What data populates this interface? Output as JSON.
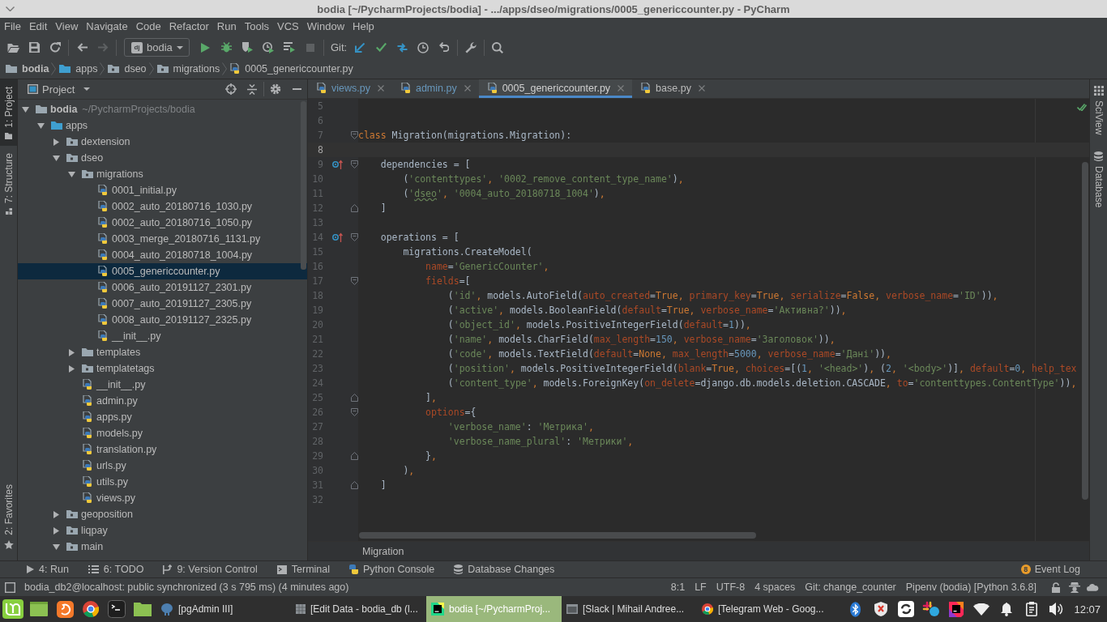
{
  "window": {
    "title": "bodia [~/PycharmProjects/bodia] - .../apps/dseo/migrations/0005_genericcounter.py - PyCharm"
  },
  "menu": [
    "File",
    "Edit",
    "View",
    "Navigate",
    "Code",
    "Refactor",
    "Run",
    "Tools",
    "VCS",
    "Window",
    "Help"
  ],
  "toolbar": {
    "back_enabled": true,
    "forward_enabled": false,
    "run_configuration": {
      "badge": "dj",
      "label": "bodia"
    },
    "stop_enabled": false,
    "vcs_label": "Git:"
  },
  "breadcrumb": [
    {
      "label": "bodia",
      "kind": "root"
    },
    {
      "label": "apps",
      "kind": "source-folder"
    },
    {
      "label": "dseo",
      "kind": "package"
    },
    {
      "label": "migrations",
      "kind": "package"
    },
    {
      "label": "0005_genericcounter.py",
      "kind": "python-file"
    }
  ],
  "left_tool_windows": {
    "top": [
      {
        "label": "1: Project",
        "kind": "project",
        "selected": true
      },
      {
        "label": "7: Structure",
        "kind": "structure",
        "selected": false
      }
    ],
    "bottom": [
      {
        "label": "2: Favorites",
        "kind": "favorites",
        "selected": false
      }
    ]
  },
  "project_panel": {
    "title": "Project",
    "tree": [
      {
        "label": "bodia",
        "location": "~/PycharmProjects/bodia",
        "kind": "root",
        "expanded": true,
        "selected": false,
        "children": [
          {
            "label": "apps",
            "kind": "source-folder",
            "expanded": true,
            "selected": false,
            "children": [
              {
                "label": "dextension",
                "kind": "package",
                "expanded": false,
                "selected": false
              },
              {
                "label": "dseo",
                "kind": "package",
                "expanded": true,
                "selected": false,
                "children": [
                  {
                    "label": "migrations",
                    "kind": "package",
                    "expanded": true,
                    "selected": false,
                    "children": [
                      {
                        "label": "0001_initial.py",
                        "kind": "python-file",
                        "selected": false
                      },
                      {
                        "label": "0002_auto_20180716_1030.py",
                        "kind": "python-file",
                        "selected": false
                      },
                      {
                        "label": "0002_auto_20180716_1050.py",
                        "kind": "python-file",
                        "selected": false
                      },
                      {
                        "label": "0003_merge_20180716_1131.py",
                        "kind": "python-file",
                        "selected": false
                      },
                      {
                        "label": "0004_auto_20180718_1004.py",
                        "kind": "python-file",
                        "selected": false
                      },
                      {
                        "label": "0005_genericcounter.py",
                        "kind": "python-file",
                        "selected": true
                      },
                      {
                        "label": "0006_auto_20191127_2301.py",
                        "kind": "python-file",
                        "selected": false
                      },
                      {
                        "label": "0007_auto_20191127_2305.py",
                        "kind": "python-file",
                        "selected": false
                      },
                      {
                        "label": "0008_auto_20191127_2325.py",
                        "kind": "python-file",
                        "selected": false
                      },
                      {
                        "label": "__init__.py",
                        "kind": "python-file",
                        "selected": false
                      }
                    ]
                  },
                  {
                    "label": "templates",
                    "kind": "folder",
                    "expanded": false,
                    "selected": false
                  },
                  {
                    "label": "templatetags",
                    "kind": "package",
                    "expanded": false,
                    "selected": false
                  },
                  {
                    "label": "__init__.py",
                    "kind": "python-file",
                    "selected": false
                  },
                  {
                    "label": "admin.py",
                    "kind": "python-file",
                    "selected": false
                  },
                  {
                    "label": "apps.py",
                    "kind": "python-file",
                    "selected": false
                  },
                  {
                    "label": "models.py",
                    "kind": "python-file",
                    "selected": false
                  },
                  {
                    "label": "translation.py",
                    "kind": "python-file",
                    "selected": false
                  },
                  {
                    "label": "urls.py",
                    "kind": "python-file",
                    "selected": false
                  },
                  {
                    "label": "utils.py",
                    "kind": "python-file",
                    "selected": false
                  },
                  {
                    "label": "views.py",
                    "kind": "python-file",
                    "selected": false
                  }
                ]
              },
              {
                "label": "geoposition",
                "kind": "package",
                "expanded": false,
                "selected": false
              },
              {
                "label": "liqpay",
                "kind": "package",
                "expanded": false,
                "selected": false
              },
              {
                "label": "main",
                "kind": "package",
                "expanded": true,
                "selected": false
              }
            ]
          }
        ]
      }
    ]
  },
  "editor": {
    "tabs": [
      {
        "label": "views.py",
        "selected": false,
        "modified": true
      },
      {
        "label": "admin.py",
        "selected": false,
        "modified": true
      },
      {
        "label": "0005_genericcounter.py",
        "selected": true,
        "modified": false
      },
      {
        "label": "base.py",
        "selected": false,
        "modified": false
      }
    ],
    "lines": [
      {
        "number": "5",
        "current": false,
        "fold_start": false,
        "fold_end": false,
        "overrides": false
      },
      {
        "number": "6",
        "current": false,
        "fold_start": false,
        "fold_end": false,
        "overrides": false
      },
      {
        "number": "7",
        "current": false,
        "fold_start": true,
        "fold_end": false,
        "overrides": false,
        "tokens": [
          {
            "kind": "keyword",
            "text": "class"
          },
          {
            "kind": "plain",
            "text": " Migration(migrations.Migration):"
          }
        ]
      },
      {
        "number": "8",
        "current": true,
        "fold_start": false,
        "fold_end": false,
        "overrides": false
      },
      {
        "number": "9",
        "current": false,
        "fold_start": true,
        "fold_end": false,
        "overrides": true,
        "tokens": [
          {
            "kind": "plain",
            "text": "    dependencies = ["
          }
        ]
      },
      {
        "number": "10",
        "current": false,
        "fold_start": false,
        "fold_end": false,
        "overrides": false,
        "tokens": [
          {
            "kind": "plain",
            "text": "        ("
          },
          {
            "kind": "string",
            "text": "'contenttypes'"
          },
          {
            "kind": "comma",
            "text": ", "
          },
          {
            "kind": "string",
            "text": "'0002_remove_content_type_name'"
          },
          {
            "kind": "plain",
            "text": ")"
          },
          {
            "kind": "comma",
            "text": ","
          }
        ]
      },
      {
        "number": "11",
        "current": false,
        "fold_start": false,
        "fold_end": false,
        "overrides": false,
        "tokens": [
          {
            "kind": "plain",
            "text": "        ("
          },
          {
            "kind": "string",
            "text": "'"
          },
          {
            "kind": "typo",
            "text": "dseo"
          },
          {
            "kind": "string",
            "text": "'"
          },
          {
            "kind": "comma",
            "text": ", "
          },
          {
            "kind": "string",
            "text": "'0004_auto_20180718_1004'"
          },
          {
            "kind": "plain",
            "text": ")"
          },
          {
            "kind": "comma",
            "text": ","
          }
        ]
      },
      {
        "number": "12",
        "current": false,
        "fold_start": false,
        "fold_end": true,
        "overrides": false,
        "tokens": [
          {
            "kind": "plain",
            "text": "    ]"
          }
        ]
      },
      {
        "number": "13",
        "current": false,
        "fold_start": false,
        "fold_end": false,
        "overrides": false
      },
      {
        "number": "14",
        "current": false,
        "fold_start": true,
        "fold_end": false,
        "overrides": true,
        "tokens": [
          {
            "kind": "plain",
            "text": "    operations = ["
          }
        ]
      },
      {
        "number": "15",
        "current": false,
        "fold_start": false,
        "fold_end": false,
        "overrides": false,
        "tokens": [
          {
            "kind": "plain",
            "text": "        migrations.CreateModel("
          }
        ]
      },
      {
        "number": "16",
        "current": false,
        "fold_start": false,
        "fold_end": false,
        "overrides": false,
        "tokens": [
          {
            "kind": "param",
            "text": "            name"
          },
          {
            "kind": "plain",
            "text": "="
          },
          {
            "kind": "string",
            "text": "'GenericCounter'"
          },
          {
            "kind": "comma",
            "text": ","
          }
        ]
      },
      {
        "number": "17",
        "current": false,
        "fold_start": true,
        "fold_end": false,
        "overrides": false,
        "tokens": [
          {
            "kind": "param",
            "text": "            fields"
          },
          {
            "kind": "plain",
            "text": "=["
          }
        ]
      },
      {
        "number": "18",
        "current": false,
        "fold_start": false,
        "fold_end": false,
        "overrides": false,
        "tokens": [
          {
            "kind": "plain",
            "text": "                ("
          },
          {
            "kind": "string",
            "text": "'id'"
          },
          {
            "kind": "comma",
            "text": ", "
          },
          {
            "kind": "plain",
            "text": "models.AutoField("
          },
          {
            "kind": "param",
            "text": "auto_created"
          },
          {
            "kind": "plain",
            "text": "="
          },
          {
            "kind": "keyword",
            "text": "True"
          },
          {
            "kind": "comma",
            "text": ", "
          },
          {
            "kind": "param",
            "text": "primary_key"
          },
          {
            "kind": "plain",
            "text": "="
          },
          {
            "kind": "keyword",
            "text": "True"
          },
          {
            "kind": "comma",
            "text": ", "
          },
          {
            "kind": "param",
            "text": "serialize"
          },
          {
            "kind": "plain",
            "text": "="
          },
          {
            "kind": "keyword",
            "text": "False"
          },
          {
            "kind": "comma",
            "text": ", "
          },
          {
            "kind": "param",
            "text": "verbose_name"
          },
          {
            "kind": "plain",
            "text": "="
          },
          {
            "kind": "string",
            "text": "'ID'"
          },
          {
            "kind": "plain",
            "text": "))"
          },
          {
            "kind": "comma",
            "text": ","
          }
        ]
      },
      {
        "number": "19",
        "current": false,
        "fold_start": false,
        "fold_end": false,
        "overrides": false,
        "tokens": [
          {
            "kind": "plain",
            "text": "                ("
          },
          {
            "kind": "string",
            "text": "'active'"
          },
          {
            "kind": "comma",
            "text": ", "
          },
          {
            "kind": "plain",
            "text": "models.BooleanField("
          },
          {
            "kind": "param",
            "text": "default"
          },
          {
            "kind": "plain",
            "text": "="
          },
          {
            "kind": "keyword",
            "text": "True"
          },
          {
            "kind": "comma",
            "text": ", "
          },
          {
            "kind": "param",
            "text": "verbose_name"
          },
          {
            "kind": "plain",
            "text": "="
          },
          {
            "kind": "string",
            "text": "'Активна?'"
          },
          {
            "kind": "plain",
            "text": "))"
          },
          {
            "kind": "comma",
            "text": ","
          }
        ]
      },
      {
        "number": "20",
        "current": false,
        "fold_start": false,
        "fold_end": false,
        "overrides": false,
        "tokens": [
          {
            "kind": "plain",
            "text": "                ("
          },
          {
            "kind": "string",
            "text": "'object_id'"
          },
          {
            "kind": "comma",
            "text": ", "
          },
          {
            "kind": "plain",
            "text": "models.PositiveIntegerField("
          },
          {
            "kind": "param",
            "text": "default"
          },
          {
            "kind": "plain",
            "text": "="
          },
          {
            "kind": "number",
            "text": "1"
          },
          {
            "kind": "plain",
            "text": "))"
          },
          {
            "kind": "comma",
            "text": ","
          }
        ]
      },
      {
        "number": "21",
        "current": false,
        "fold_start": false,
        "fold_end": false,
        "overrides": false,
        "tokens": [
          {
            "kind": "plain",
            "text": "                ("
          },
          {
            "kind": "string",
            "text": "'name'"
          },
          {
            "kind": "comma",
            "text": ", "
          },
          {
            "kind": "plain",
            "text": "models.CharField("
          },
          {
            "kind": "param",
            "text": "max_length"
          },
          {
            "kind": "plain",
            "text": "="
          },
          {
            "kind": "number",
            "text": "150"
          },
          {
            "kind": "comma",
            "text": ", "
          },
          {
            "kind": "param",
            "text": "verbose_name"
          },
          {
            "kind": "plain",
            "text": "="
          },
          {
            "kind": "string",
            "text": "'Заголовок'"
          },
          {
            "kind": "plain",
            "text": "))"
          },
          {
            "kind": "comma",
            "text": ","
          }
        ]
      },
      {
        "number": "22",
        "current": false,
        "fold_start": false,
        "fold_end": false,
        "overrides": false,
        "tokens": [
          {
            "kind": "plain",
            "text": "                ("
          },
          {
            "kind": "string",
            "text": "'code'"
          },
          {
            "kind": "comma",
            "text": ", "
          },
          {
            "kind": "plain",
            "text": "models.TextField("
          },
          {
            "kind": "param",
            "text": "default"
          },
          {
            "kind": "plain",
            "text": "="
          },
          {
            "kind": "keyword",
            "text": "None"
          },
          {
            "kind": "comma",
            "text": ", "
          },
          {
            "kind": "param",
            "text": "max_length"
          },
          {
            "kind": "plain",
            "text": "="
          },
          {
            "kind": "number",
            "text": "5000"
          },
          {
            "kind": "comma",
            "text": ", "
          },
          {
            "kind": "param",
            "text": "verbose_name"
          },
          {
            "kind": "plain",
            "text": "="
          },
          {
            "kind": "string",
            "text": "'Дані'"
          },
          {
            "kind": "plain",
            "text": "))"
          },
          {
            "kind": "comma",
            "text": ","
          }
        ]
      },
      {
        "number": "23",
        "current": false,
        "fold_start": false,
        "fold_end": false,
        "overrides": false,
        "tokens": [
          {
            "kind": "plain",
            "text": "                ("
          },
          {
            "kind": "string",
            "text": "'position'"
          },
          {
            "kind": "comma",
            "text": ", "
          },
          {
            "kind": "plain",
            "text": "models.PositiveIntegerField("
          },
          {
            "kind": "param",
            "text": "blank"
          },
          {
            "kind": "plain",
            "text": "="
          },
          {
            "kind": "keyword",
            "text": "True"
          },
          {
            "kind": "comma",
            "text": ", "
          },
          {
            "kind": "param",
            "text": "choices"
          },
          {
            "kind": "plain",
            "text": "=[("
          },
          {
            "kind": "number",
            "text": "1"
          },
          {
            "kind": "comma",
            "text": ", "
          },
          {
            "kind": "string",
            "text": "'<head>'"
          },
          {
            "kind": "plain",
            "text": ")"
          },
          {
            "kind": "comma",
            "text": ", "
          },
          {
            "kind": "plain",
            "text": "("
          },
          {
            "kind": "number",
            "text": "2"
          },
          {
            "kind": "comma",
            "text": ", "
          },
          {
            "kind": "string",
            "text": "'<body>'"
          },
          {
            "kind": "plain",
            "text": ")]"
          },
          {
            "kind": "comma",
            "text": ", "
          },
          {
            "kind": "param",
            "text": "default"
          },
          {
            "kind": "plain",
            "text": "="
          },
          {
            "kind": "number",
            "text": "0"
          },
          {
            "kind": "comma",
            "text": ", "
          },
          {
            "kind": "param",
            "text": "help_tex"
          }
        ]
      },
      {
        "number": "24",
        "current": false,
        "fold_start": false,
        "fold_end": false,
        "overrides": false,
        "tokens": [
          {
            "kind": "plain",
            "text": "                ("
          },
          {
            "kind": "string",
            "text": "'content_type'"
          },
          {
            "kind": "comma",
            "text": ", "
          },
          {
            "kind": "plain",
            "text": "models.ForeignKey("
          },
          {
            "kind": "param",
            "text": "on_delete"
          },
          {
            "kind": "plain",
            "text": "=django.db.models.deletion.CASCADE"
          },
          {
            "kind": "comma",
            "text": ", "
          },
          {
            "kind": "param",
            "text": "to"
          },
          {
            "kind": "plain",
            "text": "="
          },
          {
            "kind": "string",
            "text": "'contenttypes.ContentType'"
          },
          {
            "kind": "plain",
            "text": "))"
          },
          {
            "kind": "comma",
            "text": ","
          }
        ]
      },
      {
        "number": "25",
        "current": false,
        "fold_start": false,
        "fold_end": true,
        "overrides": false,
        "tokens": [
          {
            "kind": "plain",
            "text": "            ]"
          },
          {
            "kind": "comma",
            "text": ","
          }
        ]
      },
      {
        "number": "26",
        "current": false,
        "fold_start": true,
        "fold_end": false,
        "overrides": false,
        "tokens": [
          {
            "kind": "param",
            "text": "            options"
          },
          {
            "kind": "plain",
            "text": "={"
          }
        ]
      },
      {
        "number": "27",
        "current": false,
        "fold_start": false,
        "fold_end": false,
        "overrides": false,
        "tokens": [
          {
            "kind": "string",
            "text": "                'verbose_name'"
          },
          {
            "kind": "plain",
            "text": ": "
          },
          {
            "kind": "string",
            "text": "'Метрика'"
          },
          {
            "kind": "comma",
            "text": ","
          }
        ]
      },
      {
        "number": "28",
        "current": false,
        "fold_start": false,
        "fold_end": false,
        "overrides": false,
        "tokens": [
          {
            "kind": "string",
            "text": "                'verbose_name_plural'"
          },
          {
            "kind": "plain",
            "text": ": "
          },
          {
            "kind": "string",
            "text": "'Метрики'"
          },
          {
            "kind": "comma",
            "text": ","
          }
        ]
      },
      {
        "number": "29",
        "current": false,
        "fold_start": false,
        "fold_end": true,
        "overrides": false,
        "tokens": [
          {
            "kind": "plain",
            "text": "            }"
          },
          {
            "kind": "comma",
            "text": ","
          }
        ]
      },
      {
        "number": "30",
        "current": false,
        "fold_start": false,
        "fold_end": false,
        "overrides": false,
        "tokens": [
          {
            "kind": "plain",
            "text": "        )"
          },
          {
            "kind": "comma",
            "text": ","
          }
        ]
      },
      {
        "number": "31",
        "current": false,
        "fold_start": false,
        "fold_end": true,
        "overrides": false,
        "tokens": [
          {
            "kind": "plain",
            "text": "    ]"
          }
        ]
      },
      {
        "number": "32",
        "current": false,
        "fold_start": false,
        "fold_end": false,
        "overrides": false
      }
    ],
    "breadcrumb": "Migration"
  },
  "right_tool_windows": [
    {
      "label": "SciView",
      "kind": "sciview"
    },
    {
      "label": "Database",
      "kind": "database"
    }
  ],
  "bottom_tool_windows": {
    "tabs": [
      {
        "label": "4: Run",
        "kind": "run"
      },
      {
        "label": "6: TODO",
        "kind": "todo"
      },
      {
        "label": "9: Version Control",
        "kind": "vcs"
      },
      {
        "label": "Terminal",
        "kind": "terminal"
      },
      {
        "label": "Python Console",
        "kind": "python"
      },
      {
        "label": "Database Changes",
        "kind": "database"
      }
    ],
    "event_log": {
      "label": "Event Log",
      "count": "8"
    }
  },
  "status_bar": {
    "message": "bodia_db2@localhost: public synchronized (3 s 795 ms) (4 minutes ago)",
    "items": [
      "8:1",
      "LF",
      "UTF-8",
      "4 spaces",
      "Git: change_counter",
      "Pipenv (bodia) [Python 3.6.8]"
    ]
  },
  "taskbar": {
    "windows": [
      {
        "label": "[pgAdmin III]",
        "kind": "pgadmin",
        "selected": false
      },
      {
        "label": "[Edit Data - bodia_db (l...",
        "kind": "table",
        "selected": false
      },
      {
        "label": "bodia [~/PycharmProj...",
        "kind": "ide",
        "selected": true
      },
      {
        "label": "[Slack | Mihail Andree...",
        "kind": "window",
        "selected": false
      },
      {
        "label": "[Telegram Web - Goog...",
        "kind": "browser",
        "selected": false
      }
    ],
    "clock": "12:07"
  }
}
